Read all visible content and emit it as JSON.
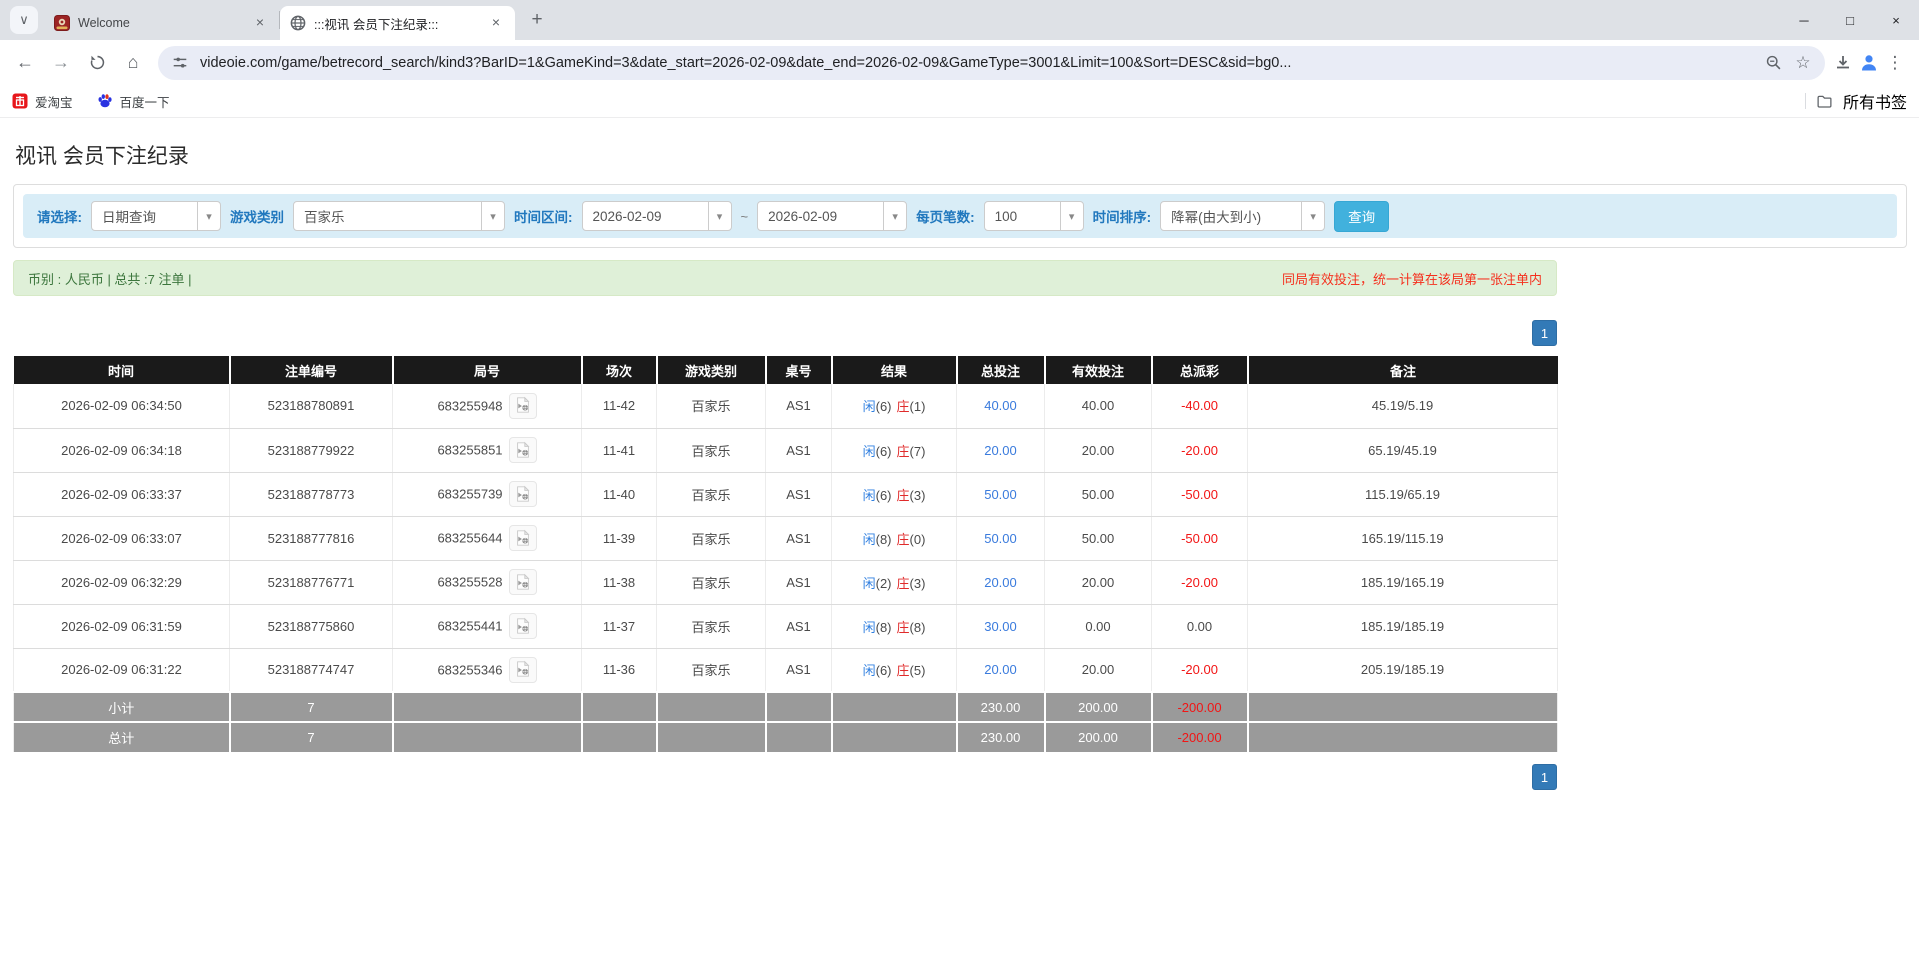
{
  "browser": {
    "tabs": [
      {
        "title": "Welcome"
      },
      {
        "title": ":::视讯 会员下注纪录:::",
        "active": true
      }
    ],
    "url": "videoie.com/game/betrecord_search/kind3?BarID=1&GameKind=3&date_start=2026-02-09&date_end=2026-02-09&GameType=3001&Limit=100&Sort=DESC&sid=bg0...",
    "bookmarks": [
      {
        "label": "爱淘宝",
        "icon": "taobao-icon"
      },
      {
        "label": "百度一下",
        "icon": "baidu-paw-icon"
      }
    ],
    "all_bookmarks_label": "所有书签"
  },
  "icons": {
    "close": "×",
    "new_tab": "+",
    "tab_chevron": "∨",
    "caret": "▾",
    "back": "←",
    "forward": "→",
    "home": "⌂",
    "star": "☆",
    "menu": "⋮",
    "minimize": "─",
    "maximize": "□"
  },
  "colors": {
    "accent_blue": "#337ab7",
    "bet_amount_blue": "#3a7bdd",
    "loss_red": "#f21515",
    "warning_red": "#f5301e",
    "filter_bar_bg": "#d9edf7",
    "summary_green_bg": "#dff0d8",
    "summary_green_text": "#3c763d",
    "table_header_bg": "#1a1a1a",
    "totals_grey_bg": "#9a9a9a",
    "search_button_bg": "#41b1dd"
  },
  "page": {
    "title": "视讯 会员下注纪录",
    "filters": {
      "select_label": "请选择:",
      "select_value": "日期查询",
      "game_kind_label": "游戏类别",
      "game_kind_value": "百家乐",
      "date_range_label": "时间区间:",
      "date_start": "2026-02-09",
      "date_separator": "~",
      "date_end": "2026-02-09",
      "per_page_label": "每页笔数:",
      "per_page_value": "100",
      "sort_label": "时间排序:",
      "sort_value": "降幂(由大到小)",
      "search_button": "查询"
    },
    "summary": {
      "left": "币别 : 人民币 | 总共 :7 注单 |",
      "right": "同局有效投注，统一计算在该局第一张注单内"
    },
    "pagination": {
      "page": "1"
    },
    "table": {
      "headers": [
        "时间",
        "注单编号",
        "局号",
        "场次",
        "游戏类别",
        "桌号",
        "结果",
        "总投注",
        "有效投注",
        "总派彩",
        "备注"
      ],
      "rows": [
        {
          "time": "2026-02-09 06:34:50",
          "bet_id": "523188780891",
          "round_id": "683255948",
          "session": "11-42",
          "game": "百家乐",
          "table_no": "AS1",
          "result_player": "闲",
          "result_player_num": "(6)",
          "result_banker": "庄",
          "result_banker_num": "(1)",
          "total_bet": "40.00",
          "valid_bet": "40.00",
          "payout": "-40.00",
          "remark": "45.19/5.19"
        },
        {
          "time": "2026-02-09 06:34:18",
          "bet_id": "523188779922",
          "round_id": "683255851",
          "session": "11-41",
          "game": "百家乐",
          "table_no": "AS1",
          "result_player": "闲",
          "result_player_num": "(6)",
          "result_banker": "庄",
          "result_banker_num": "(7)",
          "total_bet": "20.00",
          "valid_bet": "20.00",
          "payout": "-20.00",
          "remark": "65.19/45.19"
        },
        {
          "time": "2026-02-09 06:33:37",
          "bet_id": "523188778773",
          "round_id": "683255739",
          "session": "11-40",
          "game": "百家乐",
          "table_no": "AS1",
          "result_player": "闲",
          "result_player_num": "(6)",
          "result_banker": "庄",
          "result_banker_num": "(3)",
          "total_bet": "50.00",
          "valid_bet": "50.00",
          "payout": "-50.00",
          "remark": "115.19/65.19"
        },
        {
          "time": "2026-02-09 06:33:07",
          "bet_id": "523188777816",
          "round_id": "683255644",
          "session": "11-39",
          "game": "百家乐",
          "table_no": "AS1",
          "result_player": "闲",
          "result_player_num": "(8)",
          "result_banker": "庄",
          "result_banker_num": "(0)",
          "total_bet": "50.00",
          "valid_bet": "50.00",
          "payout": "-50.00",
          "remark": "165.19/115.19"
        },
        {
          "time": "2026-02-09 06:32:29",
          "bet_id": "523188776771",
          "round_id": "683255528",
          "session": "11-38",
          "game": "百家乐",
          "table_no": "AS1",
          "result_player": "闲",
          "result_player_num": "(2)",
          "result_banker": "庄",
          "result_banker_num": "(3)",
          "total_bet": "20.00",
          "valid_bet": "20.00",
          "payout": "-20.00",
          "remark": "185.19/165.19"
        },
        {
          "time": "2026-02-09 06:31:59",
          "bet_id": "523188775860",
          "round_id": "683255441",
          "session": "11-37",
          "game": "百家乐",
          "table_no": "AS1",
          "result_player": "闲",
          "result_player_num": "(8)",
          "result_banker": "庄",
          "result_banker_num": "(8)",
          "total_bet": "30.00",
          "valid_bet": "0.00",
          "payout": "0.00",
          "remark": "185.19/185.19"
        },
        {
          "time": "2026-02-09 06:31:22",
          "bet_id": "523188774747",
          "round_id": "683255346",
          "session": "11-36",
          "game": "百家乐",
          "table_no": "AS1",
          "result_player": "闲",
          "result_player_num": "(6)",
          "result_banker": "庄",
          "result_banker_num": "(5)",
          "total_bet": "20.00",
          "valid_bet": "20.00",
          "payout": "-20.00",
          "remark": "205.19/185.19"
        }
      ],
      "subtotal": {
        "label": "小计",
        "count": "7",
        "total_bet": "230.00",
        "valid_bet": "200.00",
        "payout": "-200.00"
      },
      "total": {
        "label": "总计",
        "count": "7",
        "total_bet": "230.00",
        "valid_bet": "200.00",
        "payout": "-200.00"
      }
    }
  }
}
